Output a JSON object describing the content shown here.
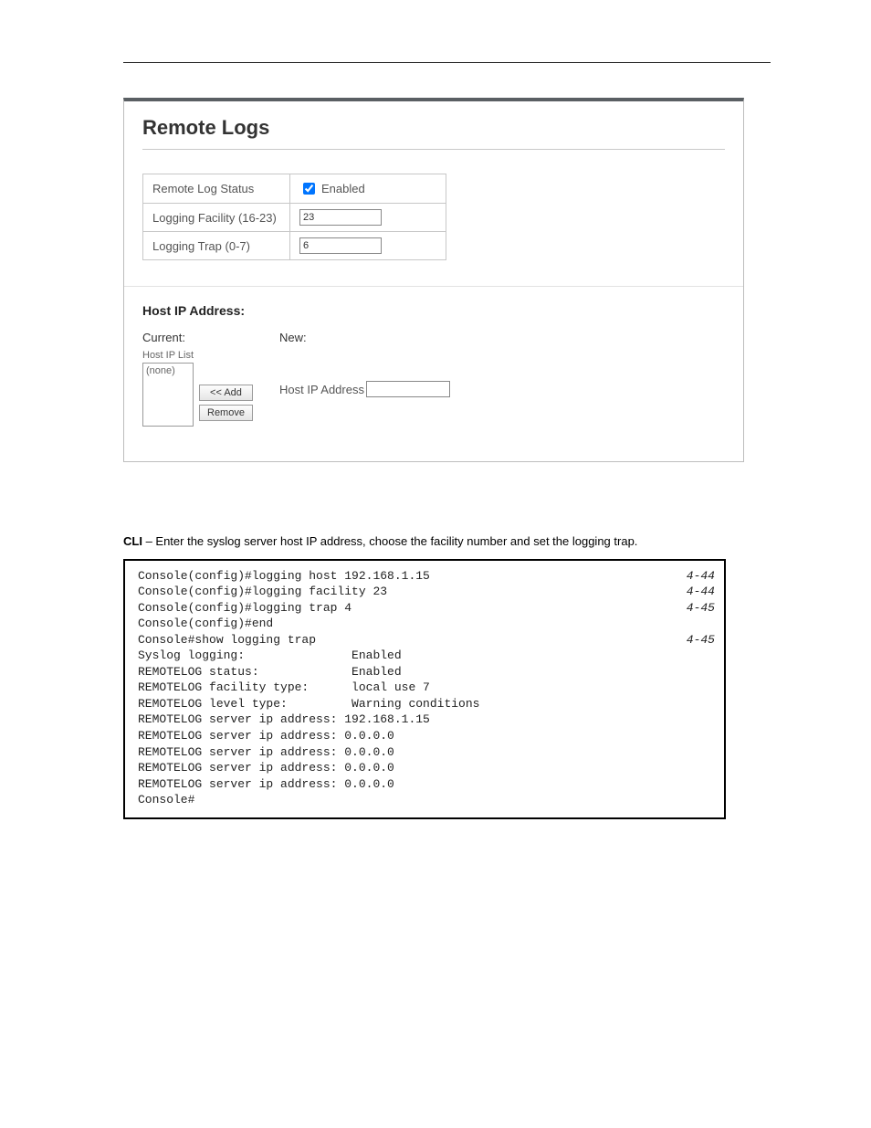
{
  "panel": {
    "title": "Remote Logs",
    "rows": {
      "status_label": "Remote Log Status",
      "status_enabled_label": "Enabled",
      "status_checked": true,
      "facility_label": "Logging Facility (16-23)",
      "facility_value": "23",
      "trap_label": "Logging Trap (0-7)",
      "trap_value": "6"
    },
    "host_section_label": "Host IP Address:",
    "current_heading": "Current:",
    "new_heading": "New:",
    "host_list_label": "Host IP List",
    "host_list_content": "(none)",
    "add_btn": "<< Add",
    "remove_btn": "Remove",
    "new_field_label": "Host IP Address",
    "new_field_value": ""
  },
  "section": {
    "prefix": "CLI",
    "desc": " – Enter the syslog server host IP address, choose the facility number and set the logging trap."
  },
  "cli": [
    {
      "left": "Console(config)#logging host 192.168.1.15",
      "right": "4-44"
    },
    {
      "left": "Console(config)#logging facility 23",
      "right": "4-44"
    },
    {
      "left": "Console(config)#logging trap 4",
      "right": "4-45"
    },
    {
      "left": "Console(config)#end",
      "right": ""
    },
    {
      "left": "Console#show logging trap",
      "right": "4-45"
    },
    {
      "left": "Syslog logging:               Enabled",
      "right": ""
    },
    {
      "left": "REMOTELOG status:             Enabled",
      "right": ""
    },
    {
      "left": "REMOTELOG facility type:      local use 7",
      "right": ""
    },
    {
      "left": "REMOTELOG level type:         Warning conditions",
      "right": ""
    },
    {
      "left": "REMOTELOG server ip address: 192.168.1.15",
      "right": ""
    },
    {
      "left": "REMOTELOG server ip address: 0.0.0.0",
      "right": ""
    },
    {
      "left": "REMOTELOG server ip address: 0.0.0.0",
      "right": ""
    },
    {
      "left": "REMOTELOG server ip address: 0.0.0.0",
      "right": ""
    },
    {
      "left": "REMOTELOG server ip address: 0.0.0.0",
      "right": ""
    },
    {
      "left": "Console#",
      "right": ""
    }
  ]
}
